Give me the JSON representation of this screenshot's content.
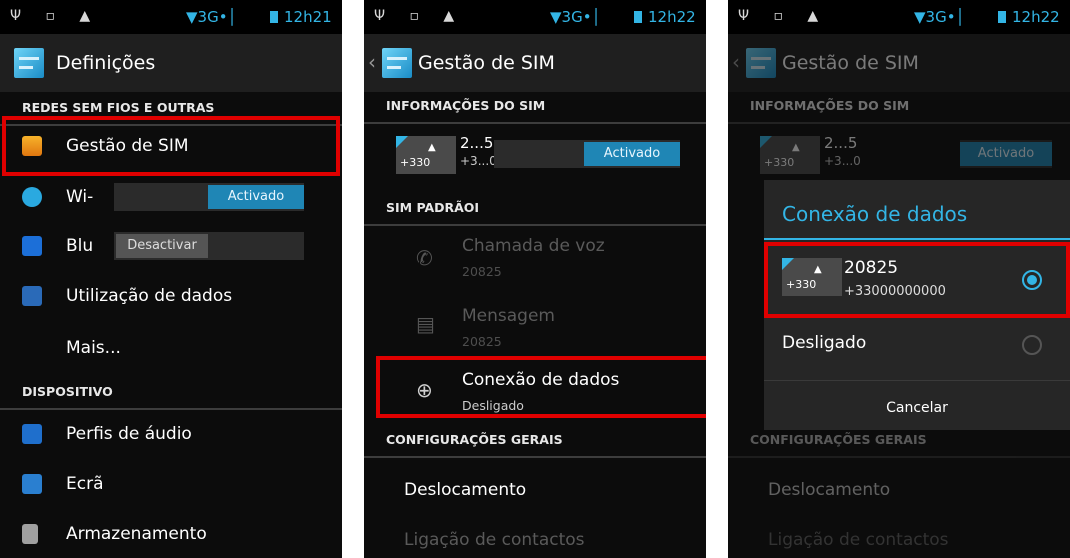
{
  "status": {
    "left_icons": "Ψ ▫ ▲",
    "network": "▼3G•│",
    "screen1_time": "12h21",
    "screen2_time": "12h22",
    "screen3_time": "12h22"
  },
  "screen1": {
    "title": "Definições",
    "section_wireless": "REDES SEM FIOS E OUTRAS",
    "items": [
      {
        "label": "Gestão de SIM"
      },
      {
        "label": "Wi-",
        "toggle": "Activado"
      },
      {
        "label": "Blu",
        "toggle": "Desactivar"
      },
      {
        "label": "Utilização de dados"
      },
      {
        "label": "Mais..."
      }
    ],
    "section_device": "DISPOSITIVO",
    "device_items": [
      {
        "label": "Perfis de áudio"
      },
      {
        "label": "Ecrã"
      },
      {
        "label": "Armazenamento"
      }
    ]
  },
  "screen2": {
    "title": "Gestão de SIM",
    "section_sim_info": "INFORMAÇÕES DO SIM",
    "sim": {
      "name": "2...5",
      "number": "+3...0",
      "card_number": "+330",
      "toggle": "Activado"
    },
    "section_default": "SIM PADRÃOI",
    "items": [
      {
        "label": "Chamada de voz",
        "sub": "20825"
      },
      {
        "label": "Mensagem",
        "sub": "20825"
      },
      {
        "label": "Conexão de dados",
        "sub": "Desligado"
      }
    ],
    "section_general": "CONFIGURAÇÕES GERAIS",
    "general_items": [
      {
        "label": "Deslocamento"
      },
      {
        "label": "Ligação de contactos"
      }
    ]
  },
  "screen3": {
    "title": "Gestão de SIM",
    "section_sim_info": "INFORMAÇÕES DO SIM",
    "sim": {
      "name": "2...5",
      "number": "+3...0",
      "card_number": "+330",
      "toggle": "Activado"
    },
    "dialog": {
      "title": "Conexão de dados",
      "option1_name": "20825",
      "option1_number": "+33000000000",
      "option1_card": "+330",
      "option2": "Desligado",
      "cancel": "Cancelar"
    },
    "section_general": "CONFIGURAÇÕES GERAIS",
    "general_items": [
      {
        "label": "Deslocamento"
      },
      {
        "label": "Ligação de contactos"
      }
    ]
  },
  "colors": {
    "accent": "#33b5e5",
    "highlight": "#e00000",
    "toggle_on": "#1f86b5"
  }
}
